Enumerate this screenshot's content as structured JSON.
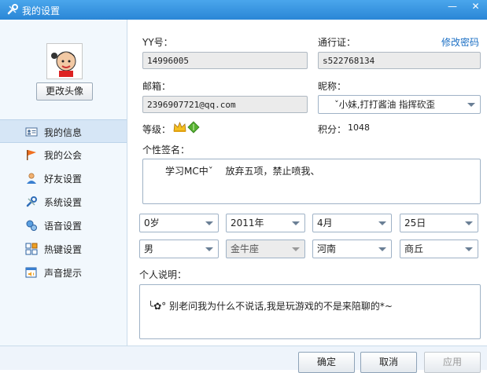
{
  "window": {
    "title": "我的设置",
    "icon": "wrench-icon",
    "minimize_label": "—",
    "close_label": "✕"
  },
  "sidebar": {
    "change_avatar_label": "更改头像",
    "items": [
      {
        "label": "我的信息",
        "icon": "id-card-icon",
        "active": true
      },
      {
        "label": "我的公会",
        "icon": "flag-icon"
      },
      {
        "label": "好友设置",
        "icon": "person-icon"
      },
      {
        "label": "系统设置",
        "icon": "wrench-icon"
      },
      {
        "label": "语音设置",
        "icon": "voice-icon"
      },
      {
        "label": "热键设置",
        "icon": "hotkey-icon"
      },
      {
        "label": "声音提示",
        "icon": "sound-icon"
      }
    ]
  },
  "profile": {
    "yy_label": "YY号：",
    "yy_value": "14996005",
    "passport_label": "通行证：",
    "passport_value": "s522768134",
    "change_password_label": "修改密码",
    "email_label": "邮箱：",
    "email_value": "2396907721@qq.com",
    "nickname_label": "昵称：",
    "nickname_value": "ˇ小妹,打打酱油 指挥砍歪",
    "level_label": "等级：",
    "points_label": "积分：",
    "points_value": "1048",
    "signature_label": "个性签名：",
    "signature_value": "学习MC中ˇ　 放弃五项，禁止喷我、",
    "age_value": "0岁",
    "year_value": "2011年",
    "month_value": "4月",
    "day_value": "25日",
    "gender_value": "男",
    "zodiac_value": "金牛座",
    "province_value": "河南",
    "city_value": "商丘",
    "description_label": "个人说明：",
    "description_value": "╰✿° 别老问我为什么不说话,我是玩游戏的不是来陪聊的*~"
  },
  "footer": {
    "ok_label": "确定",
    "cancel_label": "取消",
    "apply_label": "应用"
  }
}
